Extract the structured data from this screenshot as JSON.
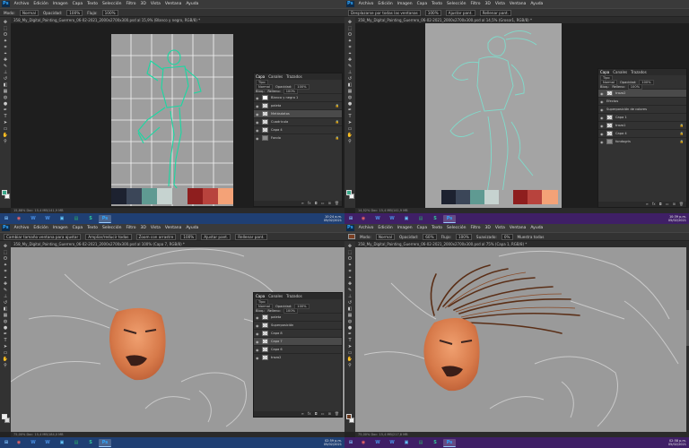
{
  "ps_logo": "Ps",
  "menu": [
    "Archivo",
    "Edición",
    "Imagen",
    "Capa",
    "Texto",
    "Selección",
    "Filtro",
    "3D",
    "Vista",
    "Ventana",
    "Ayuda"
  ],
  "doc_title": "358_My_Digital_Painting_Guerrero_06-02-2021_2000x2700x300.psd",
  "panels": {
    "tabs": [
      "Capa",
      "Canales",
      "Trazados"
    ],
    "kind_label": "Tipo",
    "mode": "Normal",
    "opacity_label": "Opacidad:",
    "opacity": "100%",
    "fill_label": "Relleno:",
    "fill": "100%",
    "lock_label": "Bloq.:"
  },
  "quadrants": [
    {
      "options": [
        "Modo:",
        "Normal",
        "Opacidad:",
        "100%",
        "Flujo:",
        "100%"
      ],
      "tab": "358_My_Digital_Painting_Guerrero_06-02-2021_2000x2700x300.psd al 15,9% (Blanco y negro, RGB/8) *",
      "status": "15,88%    Doc: 15,4 MB/141,9 MB",
      "layers": [
        {
          "name": "Blanco y negro 1",
          "thumb": "white",
          "sel": false
        },
        {
          "name": "paleta",
          "thumb": "checker",
          "sel": false
        },
        {
          "name": "Metásdatos",
          "thumb": "checker",
          "sel": true
        },
        {
          "name": "Cuadricula",
          "thumb": "checker",
          "sel": false
        },
        {
          "name": "Capa 4",
          "thumb": "checker",
          "sel": false
        },
        {
          "name": "Fondo",
          "thumb": "gray",
          "sel": false
        }
      ],
      "palette": [
        "#1d2230",
        "#3b4658",
        "#5f9a92",
        "#c6d3d0",
        "#8e1e1e",
        "#b8433d",
        "#e07c64",
        "#f4a277"
      ],
      "taskbar_time": "10:24 a.m.|05/02/2021"
    },
    {
      "options": [
        "Desplazarse por todas las ventanas",
        "100%",
        "Ajustar pant.",
        "Rellenar pant."
      ],
      "tab": "358_My_Digital_Painting_Guerrero_06-02-2021_2000x2700x300.psd al 14,5% (Grosor1, RGB/8) *",
      "status": "14,52%    Doc: 15,4 MB/141,9 MB",
      "layers": [
        {
          "name": "trazo2",
          "thumb": "checker",
          "sel": true
        },
        {
          "name": "Efectos",
          "thumb": "",
          "sel": false
        },
        {
          "name": "Superposición de colores",
          "thumb": "",
          "sel": false
        },
        {
          "name": "Capa 1",
          "thumb": "checker",
          "sel": false
        },
        {
          "name": "trazo1",
          "thumb": "checker",
          "sel": false
        },
        {
          "name": "Capa 4",
          "thumb": "checker",
          "sel": false
        },
        {
          "name": "fondogris",
          "thumb": "gray",
          "sel": false
        }
      ],
      "palette": [
        "#1d2230",
        "#3b4658",
        "#5f9a92",
        "#c6d3d0",
        "#8e1e1e",
        "#b8433d",
        "#e07c64",
        "#f4a277"
      ],
      "taskbar_time": "10:39 p.m.|05/02/2021"
    },
    {
      "options": [
        "Cambiar tamaño ventana para ajustar",
        "Ampliar/reducir todas",
        "Zoom con arrastre",
        "100%",
        "Ajustar pant.",
        "Rellenar pant."
      ],
      "tab": "358_My_Digital_Painting_Guerrero_06-02-2021_2000x2700x300.psd al 100% (Capa 7, RGB/8) *",
      "status": "75,00%    Doc: 15,4 MB/184,0 MB",
      "layers": [
        {
          "name": "paleta",
          "thumb": "checker",
          "sel": false
        },
        {
          "name": "Superposición",
          "thumb": "checker",
          "sel": false
        },
        {
          "name": "Capa 8",
          "thumb": "checker",
          "sel": false
        },
        {
          "name": "Capa 7",
          "thumb": "checker",
          "sel": true
        },
        {
          "name": "Capa 6",
          "thumb": "checker",
          "sel": false
        },
        {
          "name": "trazo2",
          "thumb": "checker",
          "sel": false
        }
      ],
      "taskbar_time": "02:59 p.m.|05/02/2021"
    },
    {
      "options": [
        "Modo:",
        "Normal",
        "Opacidad:",
        "60%",
        "Flujo:",
        "100%",
        "Suavizado:",
        "0%",
        "Muestra todas"
      ],
      "tab": "358_My_Digital_Painting_Guerrero_06-02-2021_2000x2700x300.psd al 75% (Capa 1, RGB/8) *",
      "status": "75,00%    Doc: 15,4 MB/217,8 MB",
      "taskbar_time": "02:58 p.m.|05/02/2021"
    }
  ],
  "taskbar_apps": [
    "⊞",
    "◉",
    "W",
    "W",
    "▣",
    "▤",
    "S",
    "Ps"
  ]
}
